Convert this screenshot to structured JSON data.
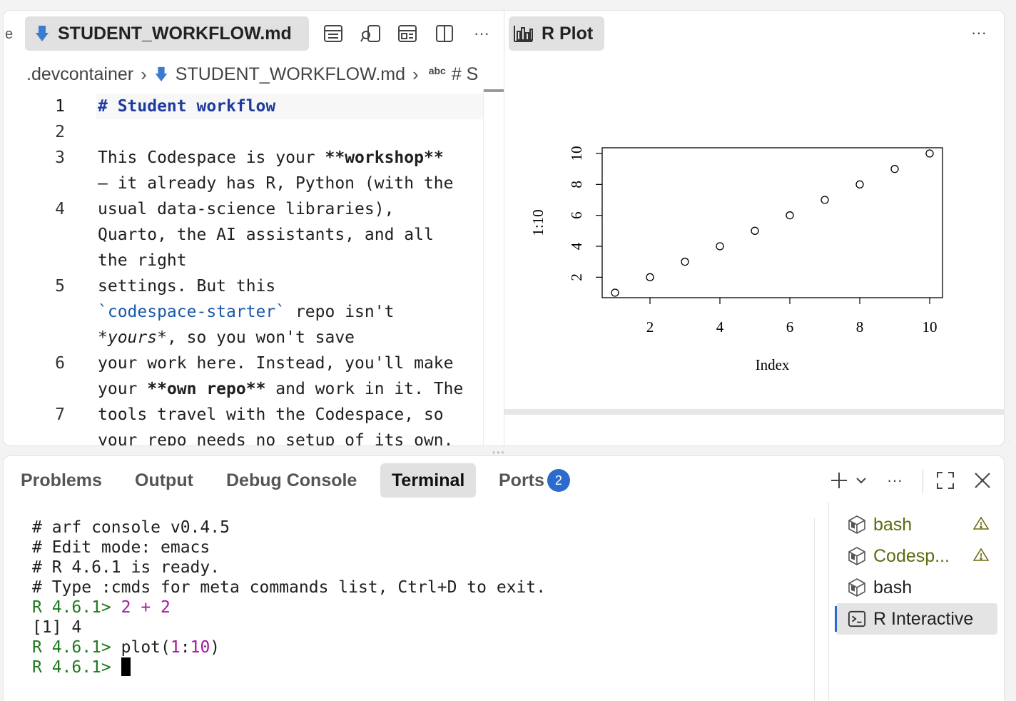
{
  "editor": {
    "left_edge_glyph": "e",
    "tab_label": "STUDENT_WORKFLOW.md",
    "more_label": "···",
    "breadcrumb": {
      "folder": ".devcontainer",
      "file": "STUDENT_WORKFLOW.md",
      "abc": "abc",
      "symbol": "# S"
    },
    "lines": [
      {
        "n": "1",
        "rows": [
          [
            {
              "t": "# Student workflow",
              "c": "heading"
            }
          ]
        ]
      },
      {
        "n": "2",
        "rows": [
          [
            {
              "t": ""
            }
          ]
        ]
      },
      {
        "n": "3",
        "rows": [
          [
            {
              "t": "This Codespace is your "
            },
            {
              "t": "**workshop**",
              "c": "bold"
            }
          ],
          [
            {
              "t": "— it already has R, Python (with the"
            }
          ]
        ]
      },
      {
        "n": "4",
        "rows": [
          [
            {
              "t": "usual data-science libraries),"
            }
          ],
          [
            {
              "t": "Quarto, the AI assistants, and all"
            }
          ],
          [
            {
              "t": "the right"
            }
          ]
        ]
      },
      {
        "n": "5",
        "rows": [
          [
            {
              "t": "settings. But this"
            }
          ],
          [
            {
              "t": "`codespace-starter`",
              "c": "codeq"
            },
            {
              "t": " repo isn't"
            }
          ],
          [
            {
              "t": "*yours*",
              "c": "ital"
            },
            {
              "t": ", so you won't save"
            }
          ]
        ]
      },
      {
        "n": "6",
        "rows": [
          [
            {
              "t": "your work here. Instead, you'll make"
            }
          ],
          [
            {
              "t": "your "
            },
            {
              "t": "**own repo**",
              "c": "bold"
            },
            {
              "t": " and work in it. The"
            }
          ]
        ]
      },
      {
        "n": "7",
        "rows": [
          [
            {
              "t": "tools travel with the Codespace, so"
            }
          ],
          [
            {
              "t": "your repo needs no setup of its own."
            }
          ]
        ]
      }
    ]
  },
  "plot_panel": {
    "tab_label": "R Plot",
    "more_label": "···"
  },
  "chart_data": {
    "type": "scatter",
    "x": [
      1,
      2,
      3,
      4,
      5,
      6,
      7,
      8,
      9,
      10
    ],
    "y": [
      1,
      2,
      3,
      4,
      5,
      6,
      7,
      8,
      9,
      10
    ],
    "xlabel": "Index",
    "ylabel": "1:10",
    "xticks": [
      "2",
      "4",
      "6",
      "8",
      "10"
    ],
    "yticks": [
      "2",
      "4",
      "6",
      "8",
      "10"
    ],
    "xlim": [
      1,
      10
    ],
    "ylim": [
      1,
      10
    ],
    "grid": false,
    "marker": "open-circle"
  },
  "panel": {
    "tabs": [
      "Problems",
      "Output",
      "Debug Console",
      "Terminal",
      "Ports"
    ],
    "active_tab": "Terminal",
    "ports_badge": "2",
    "terminal_lines": [
      [
        {
          "t": "# arf console v0.4.5"
        }
      ],
      [
        {
          "t": "# Edit mode: emacs"
        }
      ],
      [
        {
          "t": "# R 4.6.1 is ready."
        }
      ],
      [
        {
          "t": "# Type :cmds for meta commands list, Ctrl+D to exit."
        }
      ],
      [
        {
          "t": "R 4.6.1> ",
          "c": "prompt"
        },
        {
          "t": "2 + 2",
          "c": "num"
        }
      ],
      [
        {
          "t": "[1] 4"
        }
      ],
      [
        {
          "t": "R 4.6.1> ",
          "c": "prompt"
        },
        {
          "t": "plot("
        },
        {
          "t": "1",
          "c": "num"
        },
        {
          "t": ":"
        },
        {
          "t": "10",
          "c": "num"
        },
        {
          "t": ")"
        }
      ],
      [
        {
          "t": "R 4.6.1> ",
          "c": "prompt"
        },
        {
          "t": "",
          "c": "cursor"
        }
      ]
    ],
    "terminal_list": [
      {
        "label": "bash",
        "style": "green",
        "warning": true,
        "icon": "cube-icon"
      },
      {
        "label": "Codesp...",
        "style": "green",
        "warning": true,
        "icon": "cube-icon"
      },
      {
        "label": "bash",
        "style": "",
        "warning": false,
        "icon": "cube-icon"
      },
      {
        "label": "R Interactive",
        "style": "",
        "warning": false,
        "icon": "terminal-icon",
        "active": true
      }
    ],
    "more_label": "···"
  }
}
